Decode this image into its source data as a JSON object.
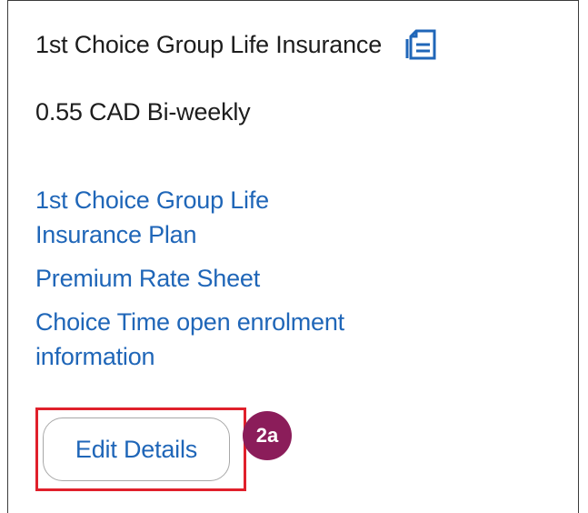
{
  "card": {
    "title": "1st Choice Group Life Insurance",
    "title_icon": "document-icon",
    "price": "0.55 CAD Bi-weekly",
    "links": [
      "1st Choice Group Life Insurance Plan",
      "Premium Rate Sheet",
      "Choice Time open enrolment information"
    ],
    "edit_button_label": "Edit Details"
  },
  "annotation": {
    "badge_label": "2a",
    "badge_color": "#8b1d5a",
    "highlight_color": "#e0202b"
  },
  "colors": {
    "link": "#1f66b8",
    "text": "#1d1d1d"
  }
}
